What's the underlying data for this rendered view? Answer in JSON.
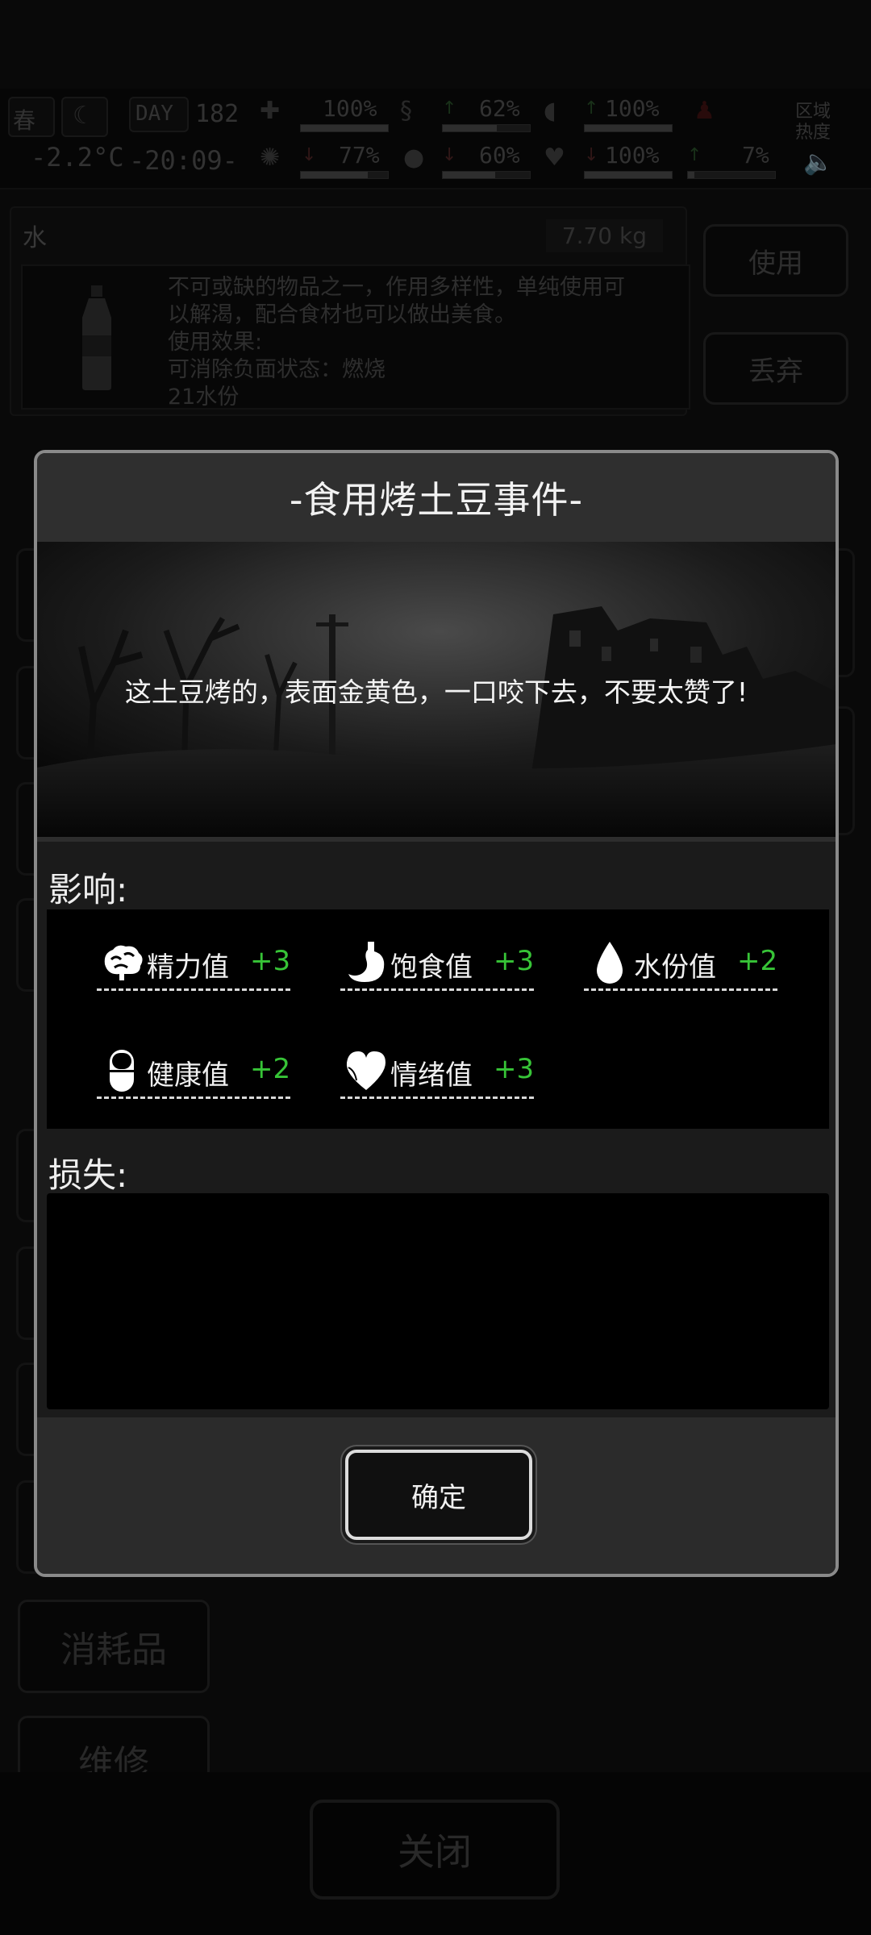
{
  "hud": {
    "season": "春",
    "day_label": "DAY",
    "day": "182",
    "temperature": "-2.2°C",
    "clock": "-20:09-",
    "region_heat_label": "区域\n热度",
    "stats": [
      {
        "icon": "medkit-icon",
        "value": "100%",
        "fill": 1.0
      },
      {
        "icon": "stomach-icon",
        "value": "62%",
        "fill": 0.62
      },
      {
        "icon": "pill-icon",
        "value": "100%",
        "fill": 1.0
      },
      {
        "icon": "brain-icon",
        "value": "77%",
        "fill": 0.77
      },
      {
        "icon": "drop-icon",
        "value": "60%",
        "fill": 0.6
      },
      {
        "icon": "heart-icon",
        "value": "100%",
        "fill": 1.0
      },
      {
        "icon": "region-heat-icon",
        "value": "7%",
        "fill": 0.07
      }
    ]
  },
  "item": {
    "name": "水",
    "weight": "7.70 kg",
    "description": "不可或缺的物品之一，作用多样性，单纯使用可\n以解渴，配合食材也可以做出美食。\n使用效果:\n可消除负面状态：燃烧\n21水份"
  },
  "actions": {
    "use": "使用",
    "discard": "丢弃"
  },
  "categories": {
    "consumables": "消耗品",
    "repair": "维修"
  },
  "close_button": "关闭",
  "dialog": {
    "title": "-食用烤土豆事件-",
    "message": "这土豆烤的，表面金黄色，一口咬下去，不要太赞了!",
    "effects_label": "影响:",
    "loss_label": "损失:",
    "effects": [
      {
        "icon": "brain-icon",
        "name": "精力值",
        "value": "+3"
      },
      {
        "icon": "stomach-icon",
        "name": "饱食值",
        "value": "+3"
      },
      {
        "icon": "drop-icon",
        "name": "水份值",
        "value": "+2"
      },
      {
        "icon": "pill-icon",
        "name": "健康值",
        "value": "+2"
      },
      {
        "icon": "heart-icon",
        "name": "情绪值",
        "value": "+3"
      }
    ],
    "losses": [],
    "confirm": "确定"
  },
  "colors": {
    "positive": "#37c437",
    "dialog_border": "#8a8a8a",
    "background": "#000000"
  }
}
